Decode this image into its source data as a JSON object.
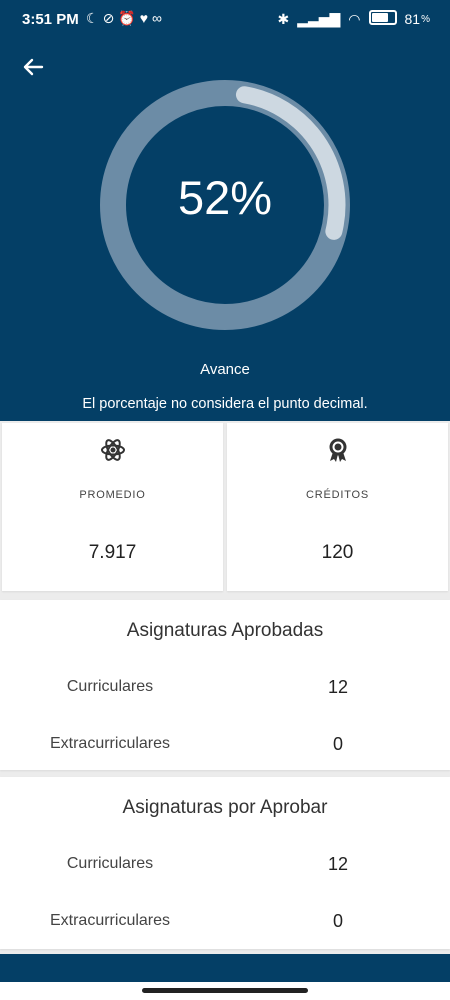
{
  "status_bar": {
    "time": "3:51 PM",
    "left_icons": [
      "moon-icon",
      "mute-icon",
      "alarm-icon",
      "heart-check-icon",
      "voicemail-icon"
    ],
    "battery_percent": "81",
    "battery_level": 0.81
  },
  "progress": {
    "value": 52,
    "label": "52%",
    "caption": "Avance",
    "note": "El porcentaje no considera el punto decimal.",
    "colors": {
      "track": "#6c8ca6",
      "fill": "#cdd8e1",
      "background": "#043f66"
    }
  },
  "stats": [
    {
      "icon": "atom-icon",
      "label": "PROMEDIO",
      "value": "7.917"
    },
    {
      "icon": "award-icon",
      "label": "CRÉDITOS",
      "value": "120"
    }
  ],
  "approved": {
    "title": "Asignaturas Aprobadas",
    "rows": [
      {
        "label": "Curriculares",
        "value": "12"
      },
      {
        "label": "Extracurriculares",
        "value": "0"
      }
    ]
  },
  "pending": {
    "title": "Asignaturas por Aprobar",
    "rows": [
      {
        "label": "Curriculares",
        "value": "12"
      },
      {
        "label": "Extracurriculares",
        "value": "0"
      }
    ]
  }
}
